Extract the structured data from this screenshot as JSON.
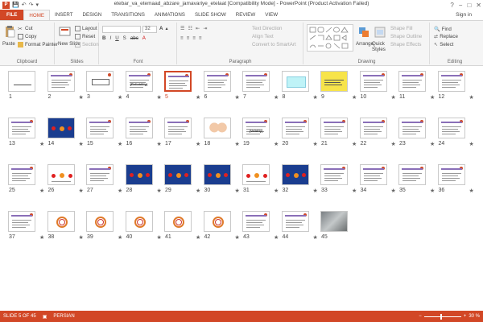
{
  "window": {
    "title": "etebar_va_etemaad_abzare_jamavariye_etelaat [Compatibility Mode] - PowerPoint (Product Activation Failed)",
    "controls": [
      "?",
      "−",
      "□",
      "✕"
    ]
  },
  "quick_access": {
    "app_icon": "P",
    "save": "💾",
    "undo": "↶",
    "redo": "↷",
    "customize": "▾"
  },
  "tabs": [
    "FILE",
    "HOME",
    "INSERT",
    "DESIGN",
    "TRANSITIONS",
    "ANIMATIONS",
    "SLIDE SHOW",
    "REVIEW",
    "VIEW"
  ],
  "active_tab": "HOME",
  "sign_in": "Sign in",
  "ribbon": {
    "clipboard": {
      "label": "Clipboard",
      "paste": "Paste",
      "cut": "Cut",
      "copy": "Copy",
      "format_painter": "Format Painter"
    },
    "slides": {
      "label": "Slides",
      "new_slide": "New Slide",
      "layout": "Layout",
      "reset": "Reset",
      "section": "Section"
    },
    "font": {
      "label": "Font",
      "size": "32"
    },
    "paragraph": {
      "label": "Paragraph",
      "text_direction": "Text Direction",
      "align_text": "Align Text",
      "convert_smartart": "Convert to SmartArt"
    },
    "drawing": {
      "label": "Drawing",
      "arrange": "Arrange",
      "quick_styles": "Quick Styles",
      "shape_fill": "Shape Fill",
      "shape_outline": "Shape Outline",
      "shape_effects": "Shape Effects"
    },
    "editing": {
      "label": "Editing",
      "find": "Find",
      "replace": "Replace",
      "select": "Select"
    }
  },
  "slides": [
    {
      "n": "1",
      "kind": "calligraphy",
      "star": false
    },
    {
      "n": "2",
      "kind": "text",
      "star": true
    },
    {
      "n": "3",
      "kind": "boxed",
      "star": true
    },
    {
      "n": "4",
      "kind": "title",
      "text": "(Reliability)",
      "star": true
    },
    {
      "n": "5",
      "kind": "text",
      "star": true,
      "selected": true
    },
    {
      "n": "6",
      "kind": "text",
      "star": true
    },
    {
      "n": "7",
      "kind": "text",
      "star": true
    },
    {
      "n": "8",
      "kind": "cyan",
      "star": true
    },
    {
      "n": "9",
      "kind": "yellow",
      "star": true
    },
    {
      "n": "10",
      "kind": "text",
      "star": true
    },
    {
      "n": "11",
      "kind": "text",
      "star": true
    },
    {
      "n": "12",
      "kind": "text",
      "star": true
    },
    {
      "n": "13",
      "kind": "text",
      "star": true
    },
    {
      "n": "14",
      "kind": "blue",
      "star": true
    },
    {
      "n": "15",
      "kind": "text",
      "star": true
    },
    {
      "n": "16",
      "kind": "text",
      "star": true
    },
    {
      "n": "17",
      "kind": "text",
      "star": true
    },
    {
      "n": "18",
      "kind": "babies",
      "star": true
    },
    {
      "n": "19",
      "kind": "title",
      "text": "(Validity)",
      "star": true
    },
    {
      "n": "20",
      "kind": "text",
      "star": true
    },
    {
      "n": "21",
      "kind": "text",
      "star": true
    },
    {
      "n": "22",
      "kind": "text",
      "star": true
    },
    {
      "n": "23",
      "kind": "text",
      "star": true
    },
    {
      "n": "24",
      "kind": "text",
      "star": true
    },
    {
      "n": "25",
      "kind": "text",
      "star": true
    },
    {
      "n": "26",
      "kind": "diagram",
      "star": true
    },
    {
      "n": "27",
      "kind": "text",
      "star": true
    },
    {
      "n": "28",
      "kind": "blue",
      "star": true
    },
    {
      "n": "29",
      "kind": "blue",
      "star": true
    },
    {
      "n": "30",
      "kind": "blue",
      "star": true
    },
    {
      "n": "31",
      "kind": "diagram",
      "star": true
    },
    {
      "n": "32",
      "kind": "blue",
      "star": true
    },
    {
      "n": "33",
      "kind": "text",
      "star": true
    },
    {
      "n": "34",
      "kind": "text",
      "star": true
    },
    {
      "n": "35",
      "kind": "text",
      "star": true
    },
    {
      "n": "36",
      "kind": "text",
      "star": true
    },
    {
      "n": "37",
      "kind": "text",
      "star": true
    },
    {
      "n": "38",
      "kind": "target",
      "star": true
    },
    {
      "n": "39",
      "kind": "target",
      "star": true
    },
    {
      "n": "40",
      "kind": "target",
      "star": true
    },
    {
      "n": "41",
      "kind": "target",
      "star": true
    },
    {
      "n": "42",
      "kind": "target",
      "star": true
    },
    {
      "n": "43",
      "kind": "text",
      "star": true
    },
    {
      "n": "44",
      "kind": "text",
      "star": true
    },
    {
      "n": "45",
      "kind": "photo",
      "star": false
    }
  ],
  "status": {
    "slide_count": "SLIDE 5 OF 45",
    "language": "PERSIAN",
    "zoom": "30 %"
  },
  "colors": {
    "accent": "#d24726",
    "ribbon_bg": "#f5f5f5"
  }
}
